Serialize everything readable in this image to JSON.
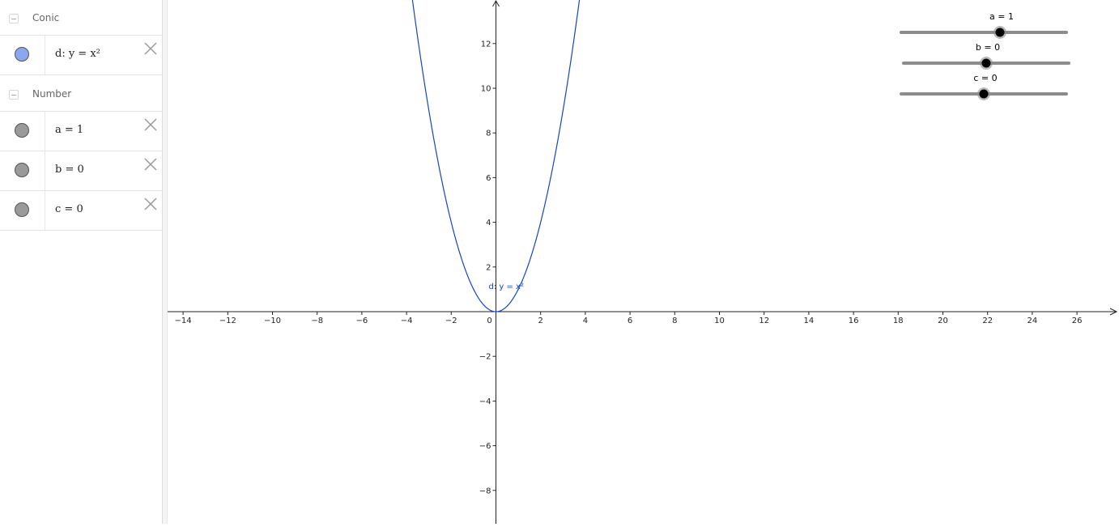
{
  "algebra": {
    "groups": [
      {
        "label": "Conic",
        "items": [
          {
            "formula": "d: y = x²",
            "color": "#8aa7ef"
          }
        ]
      },
      {
        "label": "Number",
        "items": [
          {
            "formula": "a = 1",
            "color": "#9a9a9a"
          },
          {
            "formula": "b = 0",
            "color": "#9a9a9a"
          },
          {
            "formula": "c = 0",
            "color": "#9a9a9a"
          }
        ]
      }
    ]
  },
  "graph": {
    "x_ticks": [
      "−14",
      "−12",
      "−10",
      "−8",
      "−6",
      "−4",
      "−2",
      "0",
      "2",
      "4",
      "6",
      "8",
      "10",
      "12",
      "14",
      "16",
      "18",
      "20",
      "22",
      "24",
      "26"
    ],
    "y_ticks": [
      "−8",
      "−6",
      "−4",
      "−2",
      "2",
      "4",
      "6",
      "8",
      "10",
      "12"
    ],
    "curve_label": "d: y = x²",
    "curve_color": "#1546c0"
  },
  "sliders": [
    {
      "label": "a = 1",
      "value": 1
    },
    {
      "label": "b = 0",
      "value": 0
    },
    {
      "label": "c = 0",
      "value": 0
    }
  ]
}
